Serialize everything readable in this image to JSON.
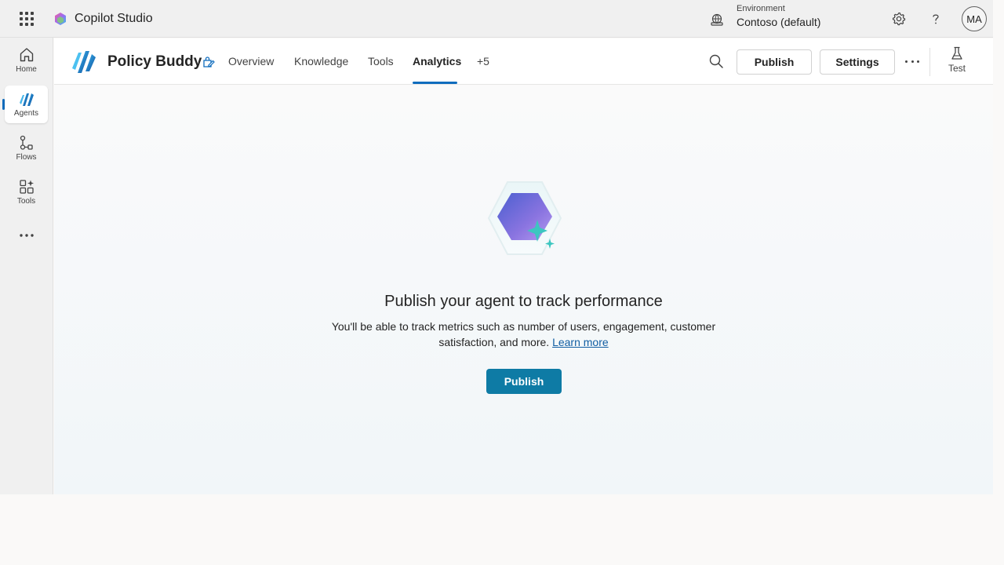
{
  "header": {
    "app_title": "Copilot Studio",
    "environment_label": "Environment",
    "environment_value": "Contoso (default)",
    "avatar_initials": "MA"
  },
  "rail": {
    "items": [
      {
        "label": "Home",
        "icon": "home-icon"
      },
      {
        "label": "Agents",
        "icon": "agents-icon",
        "active": true
      },
      {
        "label": "Flows",
        "icon": "flows-icon"
      },
      {
        "label": "Tools",
        "icon": "tools-icon"
      }
    ]
  },
  "agent": {
    "name": "Policy Buddy",
    "tabs": [
      {
        "label": "Overview"
      },
      {
        "label": "Knowledge"
      },
      {
        "label": "Tools"
      },
      {
        "label": "Analytics",
        "active": true
      },
      {
        "label": "+5"
      }
    ],
    "publish_label": "Publish",
    "settings_label": "Settings",
    "test_label": "Test"
  },
  "empty_state": {
    "title": "Publish your agent to track performance",
    "description": "You'll be able to track metrics such as number of users, engagement, customer satisfaction, and more.",
    "link_text": "Learn more",
    "button_label": "Publish"
  },
  "colors": {
    "accent": "#0f6cbd",
    "primary_button": "#0e7ba5",
    "link": "#115ea3"
  }
}
